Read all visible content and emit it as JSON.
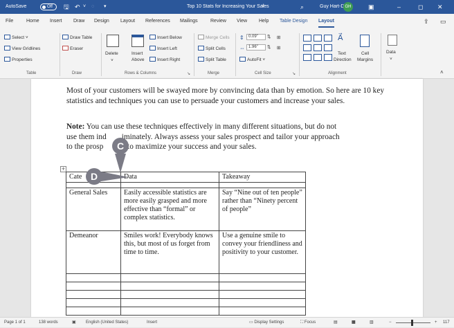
{
  "titlebar": {
    "autosave_label": "AutoSave",
    "autosave_state": "Off",
    "doc_title": "Top 10 Stats for Increasing Your Sales",
    "user_name": "Guy Hart-Davis",
    "user_initials": "GH"
  },
  "tabs": [
    "File",
    "Home",
    "Insert",
    "Draw",
    "Design",
    "Layout",
    "References",
    "Mailings",
    "Review",
    "View",
    "Help",
    "Table Design",
    "Layout"
  ],
  "ribbon": {
    "table": {
      "select": "Select",
      "gridlines": "View Gridlines",
      "properties": "Properties",
      "label": "Table"
    },
    "draw": {
      "draw_table": "Draw Table",
      "eraser": "Eraser",
      "label": "Draw"
    },
    "rows_columns": {
      "delete": "Delete",
      "insert_above_1": "Insert",
      "insert_above_2": "Above",
      "insert_below": "Insert Below",
      "insert_left": "Insert Left",
      "insert_right": "Insert Right",
      "label": "Rows & Columns"
    },
    "merge": {
      "merge_cells": "Merge Cells",
      "split_cells": "Split Cells",
      "split_table": "Split Table",
      "label": "Merge"
    },
    "cell_size": {
      "height": "0.09\"",
      "width": "1.96\"",
      "autofit": "AutoFit",
      "label": "Cell Size"
    },
    "alignment": {
      "text_direction_1": "Text",
      "text_direction_2": "Direction",
      "cell_margins_1": "Cell",
      "cell_margins_2": "Margins",
      "label": "Alignment"
    },
    "data": {
      "label": "Data"
    }
  },
  "document": {
    "para1": "Most of your customers will be swayed more by convincing data than by emotion. So here are 10 key statistics and techniques you can use to persuade your customers and increase your sales.",
    "para2_bold": "Note:",
    "para2_line1": " You can use these techniques effectively in many different situations, but do not",
    "para2_line2_a": "use them ind",
    "para2_line2_b": "iminately. Always assess your sales prospect and tailor your approach",
    "para2_line3_a": "to the prosp",
    "para2_line3_b": "o as to maximize your success and your sales.",
    "table": {
      "headers": [
        "Cate",
        "Data",
        "Takeaway"
      ],
      "rows": [
        [
          "General Sales",
          "Easily accessible statistics are more easily grasped and more effective than “formal” or complex statistics.",
          "Say “Nine out of ten people” rather than “Ninety percent of people”"
        ],
        [
          "Demeanor",
          "Smiles work! Everybody knows this, but most of us forget from time to time.",
          "Use a genuine smile to convey your friendliness and positivity to your customer."
        ]
      ]
    },
    "callout_c": "C",
    "callout_d": "D"
  },
  "statusbar": {
    "page": "Page 1 of 1",
    "words": "138 words",
    "language": "English (United States)",
    "mode": "Insert",
    "display_settings": "Display Settings",
    "focus": "Focus",
    "zoom": "117"
  }
}
